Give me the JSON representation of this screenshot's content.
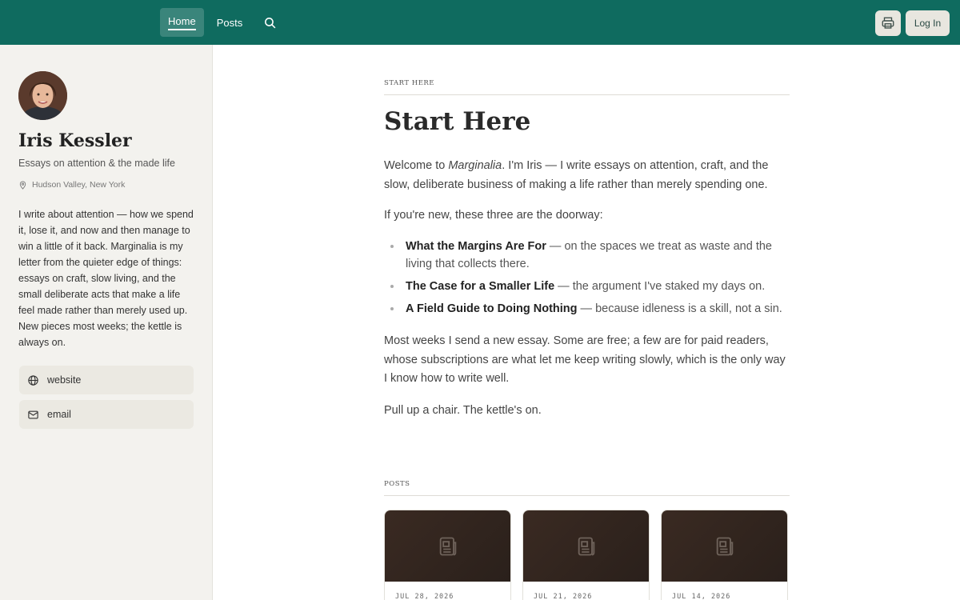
{
  "nav": {
    "items": [
      {
        "label": "Home",
        "active": true
      },
      {
        "label": "Posts",
        "active": false
      }
    ],
    "search_icon": "search-icon",
    "print_icon": "printer-icon",
    "login_label": "Log In"
  },
  "sidebar": {
    "author_name": "Iris Kessler",
    "tagline": "Essays on attention & the made life",
    "location": "Hudson Valley, New York",
    "bio": "I write about attention — how we spend it, lose it, and now and then manage to win a little of it back. Marginalia is my letter from the quieter edge of things: essays on craft, slow living, and the small deliberate acts that make a life feel made rather than merely used up. New pieces most weeks; the kettle is always on.",
    "links": [
      {
        "label": "website",
        "icon": "globe-icon"
      },
      {
        "label": "email",
        "icon": "mail-icon"
      }
    ]
  },
  "main": {
    "kicker": "START HERE",
    "title": "Start Here",
    "intro_prefix": "Welcome to ",
    "intro_publication": "Marginalia",
    "intro_suffix": ". I'm Iris — I write essays on attention, craft, and the slow, deliberate business of making a life rather than merely spending one.",
    "doorway": "If you're new, these three are the doorway:",
    "featured": [
      {
        "title": "What the Margins Are For",
        "desc": " — on the spaces we treat as waste and the living that collects there."
      },
      {
        "title": "The Case for a Smaller Life",
        "desc": " — the argument I've staked my days on."
      },
      {
        "title": "A Field Guide to Doing Nothing",
        "desc": " — because idleness is a skill, not a sin."
      }
    ],
    "subscriptions": "Most weeks I send a new essay. Some are free; a few are for paid readers, whose subscriptions are what let me keep writing slowly, which is the only way I know how to write well.",
    "closing": "Pull up a chair. The kettle's on.",
    "posts_kicker": "POSTS",
    "posts": [
      {
        "date": "JUL 28, 2026"
      },
      {
        "date": "JUL 21, 2026"
      },
      {
        "date": "JUL 14, 2026"
      }
    ]
  },
  "colors": {
    "topbar": "#0f6b5f",
    "sidebar_bg": "#f3f2ee",
    "card_thumb": "#3a2a22"
  }
}
